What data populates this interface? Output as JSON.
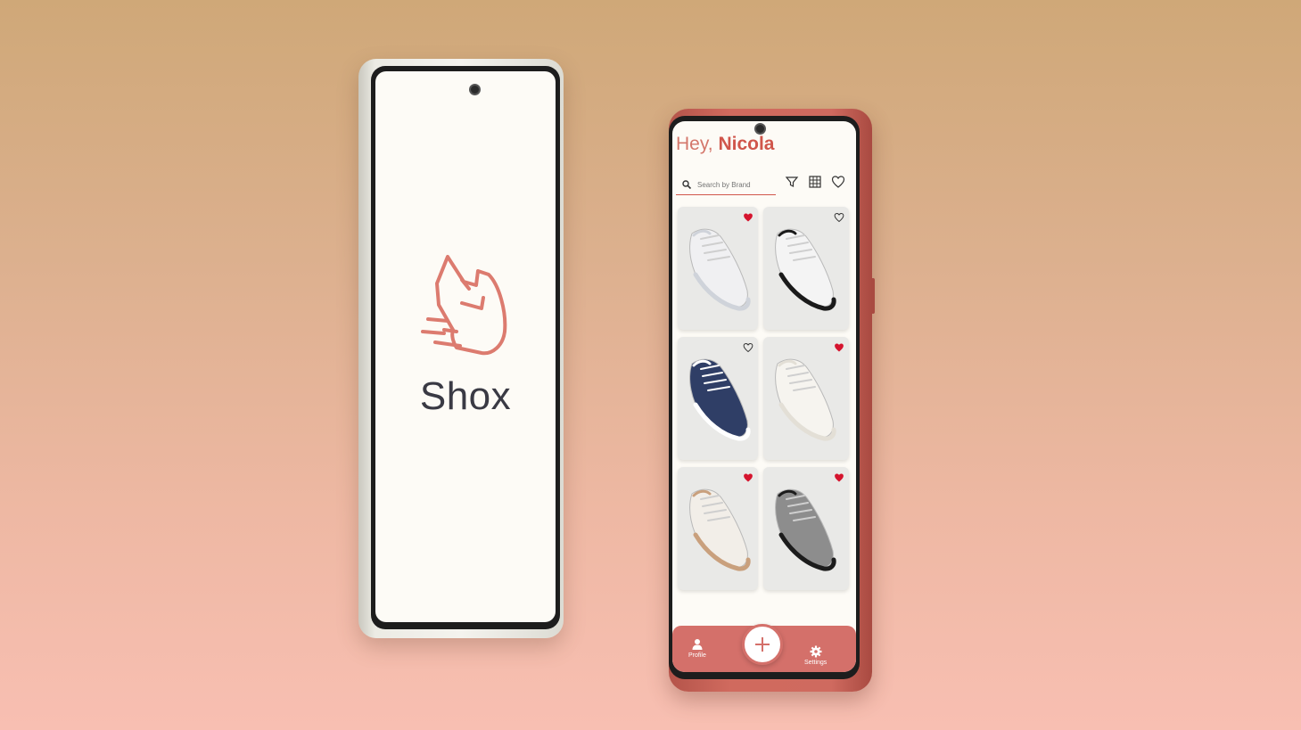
{
  "splash": {
    "app_name": "Shox",
    "logo_icon": "running-shoe-icon",
    "accent_color": "#dc7b6f",
    "text_color": "#3a3a44"
  },
  "home": {
    "greeting_prefix": "Hey, ",
    "user_name": "Nicola",
    "search_placeholder": "Search by Brand",
    "toolbar": {
      "filter_icon": "filter-icon",
      "grid_icon": "grid-view-icon",
      "favorites_icon": "heart-outline-icon"
    },
    "products": [
      {
        "shoe_color": "#f0f0f2",
        "accent": "#cfd3da",
        "favorited": true
      },
      {
        "shoe_color": "#f4f4f4",
        "accent": "#1a1a1a",
        "favorited": false
      },
      {
        "shoe_color": "#2f3e66",
        "accent": "#ffffff",
        "favorited": false
      },
      {
        "shoe_color": "#f6f4ef",
        "accent": "#e3dfd6",
        "favorited": true
      },
      {
        "shoe_color": "#f2eee8",
        "accent": "#c9a07d",
        "favorited": true
      },
      {
        "shoe_color": "#8d8d8d",
        "accent": "#1c1c1c",
        "favorited": true
      }
    ],
    "bottom_nav": {
      "profile_label": "Profile",
      "settings_label": "Settings",
      "add_icon": "plus-icon"
    },
    "brand_color": "#d4706a",
    "heart_color": "#d5142e"
  }
}
